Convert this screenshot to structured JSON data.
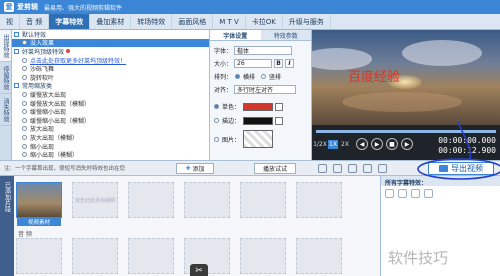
{
  "app": {
    "name": "爱剪辑",
    "tagline": "最易用、强大的视频剪辑软件",
    "logo_glyph": "爱"
  },
  "menu": {
    "tabs": [
      "视",
      "音 频",
      "字幕特效",
      "叠加素材",
      "转场特效",
      "画面风格",
      "M T V",
      "卡拉OK",
      "升级与服务"
    ],
    "active_index": 2
  },
  "left_tabs": [
    "出现特效",
    "停留特效",
    "消失特效"
  ],
  "effects_list": [
    {
      "type": "group",
      "label": "默认特效"
    },
    {
      "type": "item",
      "label": "没入效果",
      "selected": true
    },
    {
      "type": "group",
      "label": "好莱坞顶级特效",
      "badge": true
    },
    {
      "type": "item",
      "label": "点击此处获取更多好莱坞顶级特效！",
      "link": true
    },
    {
      "type": "item",
      "label": "沙砾飞舞"
    },
    {
      "type": "item",
      "label": "旋转软叶"
    },
    {
      "type": "group",
      "label": "常用缩放类"
    },
    {
      "type": "item",
      "label": "缓慢放大出现"
    },
    {
      "type": "item",
      "label": "缓慢放大出现（模糊）"
    },
    {
      "type": "item",
      "label": "缓慢缩小出现"
    },
    {
      "type": "item",
      "label": "缓慢缩小出现（模糊）"
    },
    {
      "type": "item",
      "label": "放大出现"
    },
    {
      "type": "item",
      "label": "放大出现（模糊）"
    },
    {
      "type": "item",
      "label": "缩小出现"
    },
    {
      "type": "item",
      "label": "缩小出现（模糊）"
    }
  ],
  "settings": {
    "tabs": [
      "字体设置",
      "特效参数"
    ],
    "font_label": "字体：",
    "font_value": "楷体",
    "size_label": "大小：",
    "size_value": "26",
    "bold": "B",
    "italic": "I",
    "layout_label": "排列：",
    "layout_options": [
      "横排",
      "竖排"
    ],
    "align_label": "对齐：",
    "align_value": "多行时左对齐",
    "color_label": "单色：",
    "stroke_label": "描边：",
    "image_label": "图片：",
    "text_color": "#d0392b"
  },
  "preview": {
    "title": "百度经验"
  },
  "player": {
    "speeds": [
      "1/2X",
      "1X",
      "2X"
    ],
    "active_speed": 1,
    "time_current": "00:00:00.000",
    "time_total": "00:00:12.900",
    "play_icon": "▶",
    "stop_icon": "■"
  },
  "hintbar": {
    "hint": "注：一个字幕首出现，很短写消失时特效也出在您",
    "add_label": "添加",
    "preview_label": "播放试试",
    "export_label": "导出视频"
  },
  "timeline": {
    "side_label": "已添加片段",
    "first_clip_label": "视频素材",
    "empty_hint": "双击此处添加视频",
    "audio_label": "音 频",
    "scissors": "✂"
  },
  "subpanel": {
    "title": "所有字幕特效："
  },
  "watermark": "软件技巧",
  "colors": {
    "accent": "#3b86d6",
    "annotation": "#2440c8"
  }
}
